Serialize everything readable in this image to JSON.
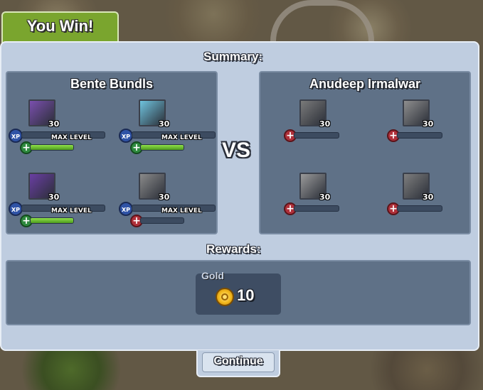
{
  "banner": {
    "title": "You Win!"
  },
  "summary": {
    "title": "Summary:"
  },
  "vs_label": "VS",
  "player": {
    "name": "Bente Bundls",
    "units": [
      {
        "icon": "purple-beast-portrait-icon",
        "level": "30",
        "xp_text": "MAX LEVEL",
        "hp_color": "green",
        "hp_fraction": 1.0,
        "portrait_color": "#7a4fae"
      },
      {
        "icon": "ice-crystal-portrait-icon",
        "level": "30",
        "xp_text": "MAX LEVEL",
        "hp_color": "green",
        "hp_fraction": 1.0,
        "portrait_color": "#6fc3de"
      },
      {
        "icon": "purple-dragon-portrait-icon",
        "level": "30",
        "xp_text": "MAX LEVEL",
        "hp_color": "green",
        "hp_fraction": 1.0,
        "portrait_color": "#6a3ea3"
      },
      {
        "icon": "grey-knight-portrait-icon",
        "level": "30",
        "xp_text": "MAX LEVEL",
        "hp_color": "red",
        "hp_fraction": 0.0,
        "portrait_color": "#8a8a8a"
      }
    ]
  },
  "opponent": {
    "name": "Anudeep Irmalwar",
    "units": [
      {
        "icon": "grey-beast-portrait-icon",
        "level": "30",
        "hp_color": "red",
        "hp_fraction": 0.0,
        "portrait_color": "#7a7a7a"
      },
      {
        "icon": "grey-warrior-portrait-icon",
        "level": "30",
        "hp_color": "red",
        "hp_fraction": 0.0,
        "portrait_color": "#8e8e8e"
      },
      {
        "icon": "grey-creature-portrait-icon",
        "level": "30",
        "hp_color": "red",
        "hp_fraction": 0.0,
        "portrait_color": "#9a9a9a"
      },
      {
        "icon": "grey-golem-portrait-icon",
        "level": "30",
        "hp_color": "red",
        "hp_fraction": 0.0,
        "portrait_color": "#7e7e7e"
      }
    ]
  },
  "rewards": {
    "title": "Rewards:",
    "gold_label": "Gold",
    "gold_value": "10"
  },
  "continue_label": "Continue"
}
